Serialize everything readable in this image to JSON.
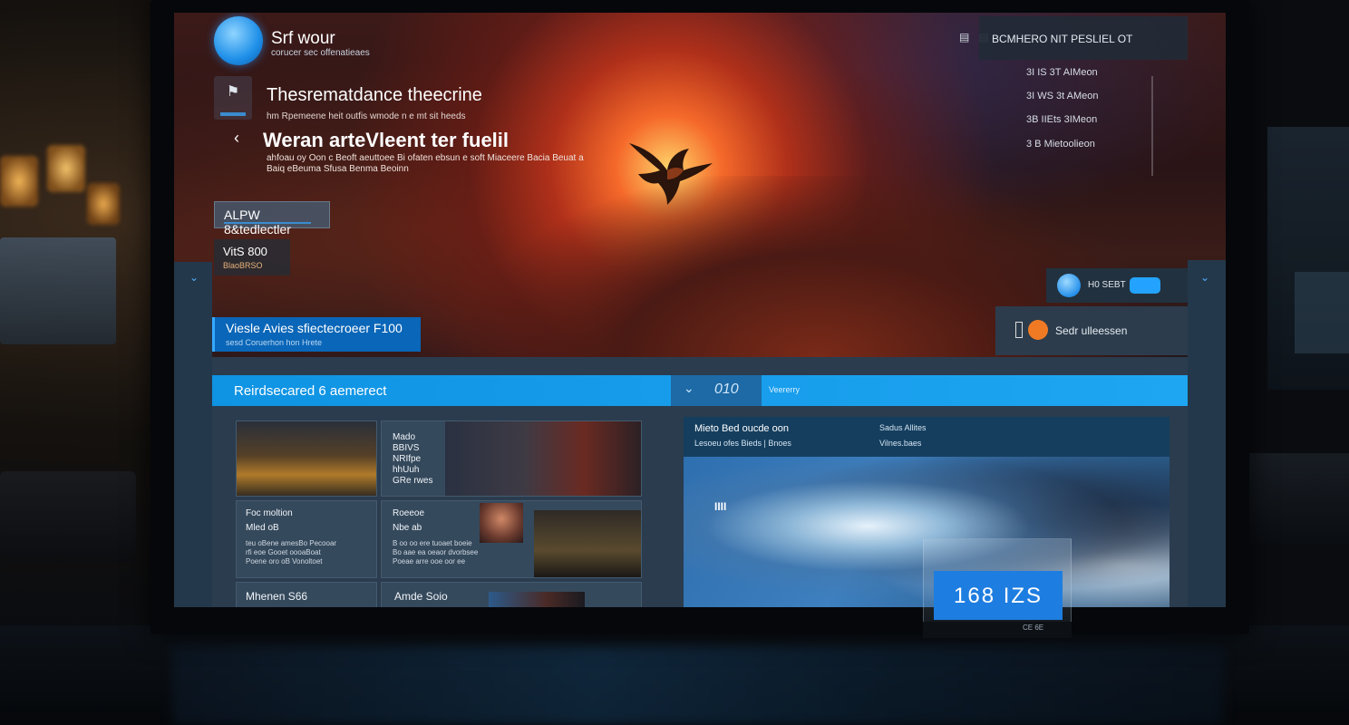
{
  "brand": {
    "name": "Srf wour",
    "tagline": "corucer sec offenatieaes"
  },
  "hero": {
    "headline": "Thesrematdance theecrine",
    "headline_sub": "hm Rpemeene heit outfis wmode n e mt sit heeds",
    "headline2": "Weran arteVleent ter fuelil",
    "headline2_sub": "ahfoau oy Oon c Beoft aeuttoee Bi ofaten ebsun e soft Miaceere Bacia Beuat a Baiq eBeuma Sfusa Benma Beoinn",
    "tag_alpha": "ALPW 8&tedlectler",
    "vibes_title": "VitS 800",
    "vibes_sub": "BlaoBRSO",
    "cta_title": "Viesle Avies sfiectecroeer  F100",
    "cta_sub": "sesd Coruerhon hon  Hrete"
  },
  "right_panel": {
    "header": "BCMHERO NIT PESLIEL OT",
    "items": [
      "3I IS 3T AIMeon",
      "3I WS 3t AMeon",
      "3B IIEts 3IMeon",
      "3 B Mietoolieon"
    ],
    "toggle_label": "H0 SEBT",
    "search_label": "Sedr ulleessen"
  },
  "section": {
    "title": "Reirdsecared 6 aemerect",
    "counter_value": "010",
    "meta": "Veererry"
  },
  "tiles": [
    {
      "caption": "Mado\nBBIVS\nNRIfpe\nhhUuh\nGRe rwes",
      "body": ""
    },
    {
      "caption": "Foc moltion",
      "sub": "Mled oB",
      "body": "teu oBene amesBo Pecooar\nrfi eoe Gooet oooaBoat\nPoene oro oB Vonoltoet"
    },
    {
      "caption": "Roeeoe",
      "sub": "Nbe ab",
      "body": "B oo oo ere tuoaet boeie\nBo aae ea oeaor dvorbsee\nPoeae arre ooe oor ee"
    },
    {
      "caption": "Mhenen S66",
      "sub": ""
    },
    {
      "caption": "Amde Soio",
      "sub": ""
    }
  ],
  "map": {
    "title": "Mieto Bed oucde oon",
    "subtitle": "Lesoeu ofes Bieds  |  Bnoes",
    "right_title": "Sadus Allites",
    "right_sub": "Vilnes.baes",
    "overlay": "IIII"
  },
  "counter_widget": {
    "value": "168  IZS",
    "base_label": "CE 6E"
  },
  "colors": {
    "accent": "#1ea6f2",
    "brand_blue": "#1e8fe8",
    "orange": "#f07a24"
  },
  "icons": [
    "logo-globe-icon",
    "bookmark-icon",
    "chevron-left-icon",
    "chevron-down-icon",
    "list-icon",
    "toggle-switch-icon"
  ]
}
